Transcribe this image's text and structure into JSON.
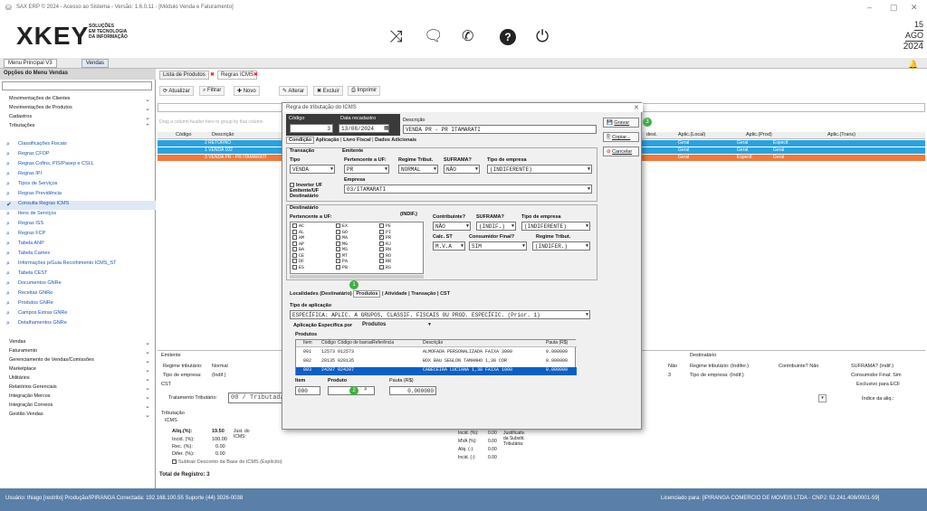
{
  "window": {
    "title": "SAX ERP © 2024 - Acesso ao Sistema - Versão: 1.6.0.11 - [Módulo Venda e Faturamento]",
    "controls": [
      "–",
      "▢",
      "✕"
    ]
  },
  "brand": {
    "name": "XKEY",
    "tagline1": "SOLUÇÕES",
    "tagline2": "EM TECNOLOGIA",
    "tagline3": "DA INFORMAÇÃO"
  },
  "date": {
    "day": "15",
    "month": "AGO",
    "year": "2024"
  },
  "top_tabs": [
    "Menu Principal V3",
    "Vendas"
  ],
  "sidebar": {
    "title": "Opções do Menu Vendas",
    "sections": [
      "Movimentações de Clientes",
      "Movimentações de Produtos",
      "Cadastros",
      "Tributações"
    ],
    "items": [
      "Classificações Fiscais",
      "Regras CFOP",
      "Regras Cofins, PIS/Pasep e CSLL",
      "Regras IPI",
      "Tipos de Serviços",
      "Regras Previdência",
      "Consulta Regras ICMS",
      "Itens de Serviços",
      "Regras ISS",
      "Regras FCP",
      "Tabela ANP",
      "Tabela Camex",
      "Informações p/Guia Recolhimento ICMS_ST",
      "Tabela CEST",
      "Documentos GNRe",
      "Receitas GNRe",
      "Produtos GNRe",
      "Campos Extras GNRe",
      "Detalhamentos GNRe"
    ],
    "bottom_sections": [
      "Vendas",
      "Faturamento",
      "Gerenciamento de Vendas/Comissões",
      "Marketplace",
      "Utilitários",
      "Relatórios Gerenciais",
      "Integração Mercos",
      "Integração Correios",
      "Gestão Vendas"
    ]
  },
  "main": {
    "subtabs": [
      "Lista de Produtos",
      "Regras ICMS"
    ],
    "toolbar": [
      "Atualizar",
      "Filtrar",
      "Novo",
      "Alterar",
      "Excluir",
      "Imprimir"
    ],
    "group_hint": "Drag a column header here to group by that column",
    "grid_headers": [
      "Código",
      "Descrição"
    ],
    "rows": [
      {
        "code": "",
        "desc": "2 RETORNO"
      },
      {
        "code": "",
        "desc": "1 VENDA 102"
      },
      {
        "code": "",
        "desc": "3 VENDA PR - PR ITAMARATI"
      }
    ],
    "right_headers": [
      "dest.",
      "Aplic.(Local)",
      "Aplic.(Prod)",
      "Aplic.(Trans)"
    ],
    "right_rows": [
      [
        "",
        "Geral",
        "Geral",
        "Especif."
      ],
      [
        "",
        "Geral",
        "Geral",
        "Geral"
      ],
      [
        "",
        "Geral",
        "Especif.",
        "Geral"
      ]
    ],
    "total": "Total de Registro: 3"
  },
  "bottom": {
    "emitente_title": "Emitente",
    "regime_label": "Regime tributário:",
    "regime_val": "Normal",
    "tipo_empresa_label": "Tipo de empresa:",
    "tipo_empresa_val": "(Indif.)",
    "cst_title": "CST",
    "trat_label": "Tratamento Tributário:",
    "trat_val": "00 / Tributada in",
    "trib_title": "Tributação",
    "icms_title": "ICMS",
    "aliq_label": "Aliq.(%):",
    "aliq_val": "19.50",
    "incid_label": "Incid. (%):",
    "incid_val": "100.00",
    "rec_label": "Rec. (%):",
    "rec_val": "0.00",
    "difer_label": "Difer. (%):",
    "difer_val": "0.00",
    "just_label": "Just. do ICMS:",
    "subtrair_label": "Subtrair Desconto da Base de ICMS (Explícito)",
    "dest_title": "Destinatário",
    "dest_regime": "Regime tributário: (Indifer.)",
    "dest_contrib": "Contribuinte? Não",
    "dest_suframa": "SUFRAMA? (Indif.)",
    "dest_tipo": "Tipo de empresa: (Indif.)",
    "dest_consumidor": "Consumidor Final: Sim",
    "exclusivo": "Exclusivo para ECF",
    "indice_aliq": "Índice da aliq.:",
    "nao": "Não",
    "three": "3",
    "st_incid": "Incid. (%):",
    "st_incid_val": "0.00",
    "mva": "MVA (%):",
    "mva_val": "0.00",
    "st_aliq": "Aliq. (-):",
    "st_aliq_val": "0.00",
    "st_incid2": "Incid. (-):",
    "st_incid2_val": "0.00",
    "justif": "Justificativ. da Substit. Tributária:"
  },
  "modal": {
    "title": "Regra de tributação do ICMS",
    "codigo_label": "Código",
    "codigo_val": "3",
    "data_label": "Data recadastro",
    "data_val": "13/08/2024",
    "descricao_label": "Descrição",
    "descricao_val": "VENDA PR - PR ITAMARATI",
    "buttons": {
      "gravar": "Gravar",
      "copiar": "Copiar...",
      "cancelar": "Cancelar"
    },
    "tabs": [
      "Condição",
      "Aplicação",
      "Livro Fiscal",
      "Dados Adicionais"
    ],
    "transacao_title": "Transação",
    "tipo_label": "Tipo",
    "tipo_val": "VENDA",
    "emitente_title": "Emitente",
    "pert_uf_label": "Pertencente a UF:",
    "pert_uf_val": "PR",
    "regime_label": "Regime Tribut.",
    "regime_val": "NORMAL",
    "suframa_label": "SUFRAMA?",
    "suframa_val": "NÃO",
    "tipo_emp_label": "Tipo de empresa",
    "tipo_emp_val": "(INDIFERENTE)",
    "inverter_label": "Inverter UF Emitente/UF Destinatário",
    "empresa_label": "Empresa",
    "empresa_val": "03/ITAMARATI",
    "dest_title": "Destinatário",
    "dest_uf_label": "Pertencente a UF:",
    "indif_label": "(INDIF.)",
    "ufs_col1": [
      "AC",
      "AL",
      "AM",
      "AP",
      "BA",
      "CE",
      "DF",
      "ES"
    ],
    "ufs_col2": [
      "EX",
      "GO",
      "MA",
      "MG",
      "MS",
      "MT",
      "PA",
      "PB"
    ],
    "ufs_col3": [
      "PE",
      "PI",
      "PR",
      "RJ",
      "RN",
      "RO",
      "RR",
      "RS"
    ],
    "contrib_label": "Contribuinte?",
    "contrib_val": "NÃO",
    "suframa2_label": "SUFRAMA?",
    "suframa2_val": "(INDIF.)",
    "tipo_emp2_label": "Tipo de empresa",
    "tipo_emp2_val": "(INDIFERENTE)",
    "calc_st_label": "Calc. ST",
    "calc_st_val": "M.V.A",
    "cons_final_label": "Consumidor Final?",
    "cons_final_val": "SIM",
    "regime2_label": "Regime Tribut.",
    "regime2_val": "(INDIFER.)",
    "subtabs": [
      "Localidades (Destinatário)",
      "Produtos",
      "Atividade",
      "Transação",
      "CST"
    ],
    "tipo_aplic_label": "Tipo de aplicação",
    "tipo_aplic_val": "ESPECÍFICA: APLIC. A GRUPOS, CLASSIF. FISCAIS OU PROD. ESPECÍFIC. (Prior. 1)",
    "aplic_esp_label": "Aplicação Específica por",
    "aplic_esp_val": "Produtos",
    "produtos_title": "Produtos",
    "prod_headers": [
      "Item",
      "Código",
      "Código de barras",
      "Referência",
      "Descrição",
      "Pauta (R$)"
    ],
    "prod_rows": [
      [
        "001",
        "12573",
        "012573",
        "",
        "ALMOFADA PERSONALIZADA FAIXA 3000",
        "0.000000"
      ],
      [
        "002",
        "20135",
        "020135",
        "",
        "BOX BAU SEGLON TAMANHO 1,38 COR",
        "0.000000"
      ],
      [
        "003",
        "24207",
        "024207",
        "",
        "CABECEIRA LUCIANA 1,38 FAIXA 1000",
        "0.000000"
      ]
    ],
    "item_label": "Item",
    "item_val": "000",
    "produto_label": "Produto",
    "produto_val": "",
    "pauta_label": "Pauta (R$)",
    "pauta_val": "0.000000"
  },
  "status": {
    "left": "Usuário: thiago [restrito]   Produção/IPIRANGA   Conectada: 192.168.100.55   Suporte (44) 3026-0038",
    "right": "Licenciado para: [IPIRANGA COMERCIO DE MOVEIS LTDA - CNPJ: 52.241.408/0001-59]"
  },
  "colors": {
    "accent": "#1a56b0",
    "row_blue": "#29a3e0",
    "row_orange": "#f07a3c",
    "status": "#5a7fa8",
    "badge": "#3cb043"
  }
}
